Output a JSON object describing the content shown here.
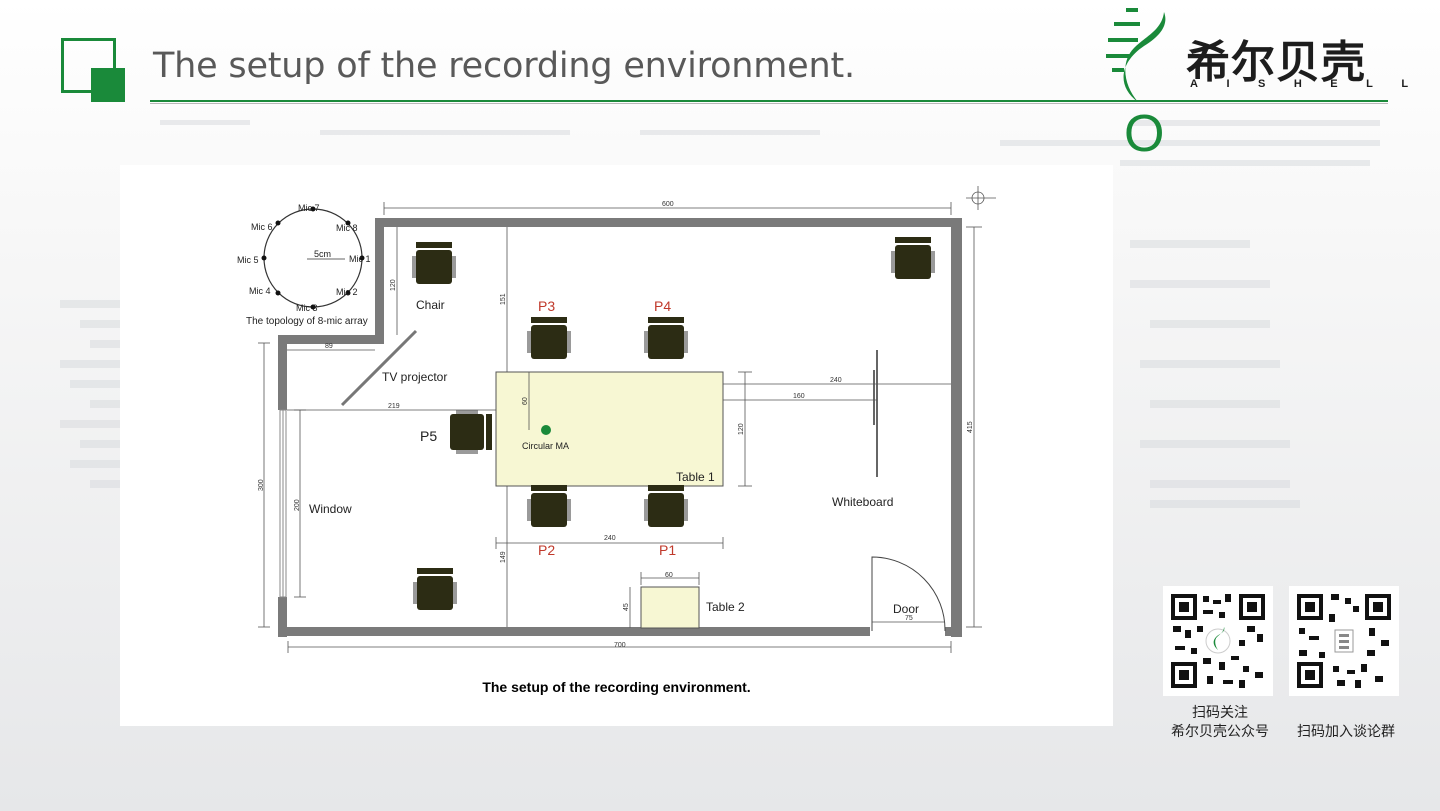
{
  "slide": {
    "title": "The setup of the recording environment.",
    "accent_color": "#1a8a3a"
  },
  "brand": {
    "name_cn": "希尔贝壳",
    "name_en": "AISHELL",
    "mark": "O"
  },
  "figure": {
    "caption": "The setup of the recording environment.",
    "mic_array": {
      "mics": [
        "Mic 1",
        "Mic 2",
        "Mic 3",
        "Mic 4",
        "Mic 5",
        "Mic 6",
        "Mic 7",
        "Mic 8"
      ],
      "radius_label": "5cm",
      "caption": "The topology of 8-mic array"
    },
    "labels": {
      "chair": "Chair",
      "tv_projector": "TV projector",
      "window": "Window",
      "table1": "Table 1",
      "table2": "Table 2",
      "whiteboard": "Whiteboard",
      "door": "Door",
      "circular_ma": "Circular MA"
    },
    "participants": [
      "P1",
      "P2",
      "P3",
      "P4",
      "P5"
    ],
    "dimensions": {
      "top_width": "600",
      "bottom_width": "700",
      "right_height": "415",
      "left_height": "300",
      "window_height": "200",
      "notch_width": "89",
      "notch_height": "120",
      "top_to_table": "151",
      "window_to_table": "219",
      "table_depth": "120",
      "mic_offset": "60",
      "table_width": "240",
      "table_to_whiteboard": "160",
      "table_to_wall": "240",
      "table_to_bottom": "149",
      "table2_width": "60",
      "table2_depth": "45",
      "door_width": "75"
    },
    "participant_color": "#c0392b"
  },
  "qr_codes": [
    {
      "caption_line1": "扫码关注",
      "caption_line2": "希尔贝壳公众号"
    },
    {
      "caption_line1": "扫码加入谈论群"
    }
  ]
}
